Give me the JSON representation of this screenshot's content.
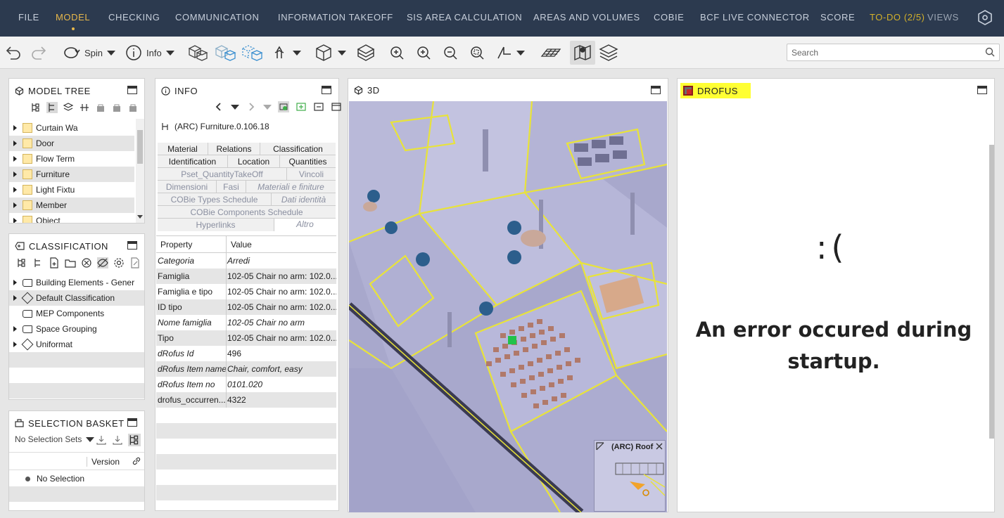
{
  "menu": [
    "FILE",
    "MODEL",
    "CHECKING",
    "COMMUNICATION",
    "INFORMATION TAKEOFF",
    "SIS AREA CALCULATION",
    "AREAS AND VOLUMES",
    "COBIE",
    "BCF LIVE CONNECTOR",
    "SCORE",
    "TO-DO (2/5)",
    "VIEWS"
  ],
  "active_menu": "MODEL",
  "toolbar": {
    "spin_label": "Spin",
    "info_label": "Info",
    "search_placeholder": "Search"
  },
  "model_tree": {
    "title": "MODEL TREE",
    "items": [
      "Curtain Wa",
      "Door",
      "Flow Term",
      "Furniture",
      "Light Fixtu",
      "Member",
      "Object"
    ]
  },
  "classification": {
    "title": "CLASSIFICATION",
    "items": [
      "Building Elements - Gener",
      "Default Classification",
      "MEP Components",
      "Space Grouping",
      "Uniformat"
    ]
  },
  "selection_basket": {
    "title": "SELECTION BASKET",
    "sets_label": "No Selection Sets",
    "column_version": "Version",
    "no_selection": "No Selection"
  },
  "info": {
    "title": "INFO",
    "object_label": "(ARC) Furniture.0.106.18",
    "tabs_row1": [
      "Material",
      "Relations",
      "Classification"
    ],
    "tabs_row2": [
      "Identification",
      "Location",
      "Quantities"
    ],
    "tabs_row3": [
      "Pset_QuantityTakeOff",
      "Vincoli"
    ],
    "tabs_row4": [
      "Dimensioni",
      "Fasi",
      "Materiali e finiture"
    ],
    "tabs_row5": [
      "COBie Types Schedule",
      "Dati identità"
    ],
    "tabs_row6": [
      "COBie Components Schedule"
    ],
    "tabs_row7": [
      "Hyperlinks",
      "Altro"
    ],
    "col_property": "Property",
    "col_value": "Value",
    "rows": [
      {
        "k": "Categoria",
        "v": "Arredi"
      },
      {
        "k": "Famiglia",
        "v": "102-05 Chair no arm: 102.0..."
      },
      {
        "k": "Famiglia e tipo",
        "v": "102-05 Chair no arm: 102.0..."
      },
      {
        "k": "ID tipo",
        "v": "102-05 Chair no arm: 102.0..."
      },
      {
        "k": "Nome famiglia",
        "v": "102-05 Chair no arm"
      },
      {
        "k": "Tipo",
        "v": "102-05 Chair no arm: 102.0..."
      },
      {
        "k": "dRofus Id",
        "v": "496"
      },
      {
        "k": "dRofus Item name",
        "v": "Chair, comfort, easy"
      },
      {
        "k": "dRofus Item no",
        "v": "0101.020"
      },
      {
        "k": "drofus_occurren...",
        "v": "4322"
      }
    ]
  },
  "view3d": {
    "title": "3D",
    "minimap_label": "(ARC) Roof"
  },
  "drofus": {
    "title": "DROFUS",
    "error_face": ":(",
    "error_message": "An error occured during startup."
  },
  "colors": {
    "topbar": "#2c3a4f",
    "accent": "#e8b84b",
    "highlight": "#ffff33"
  }
}
